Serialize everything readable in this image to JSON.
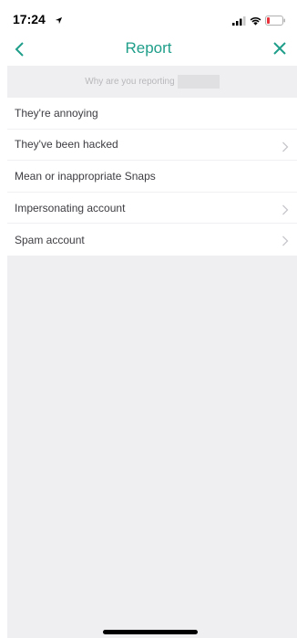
{
  "status_bar": {
    "time": "17:24",
    "icons": [
      "location-arrow-icon",
      "signal-icon",
      "wifi-icon",
      "battery-low-icon"
    ]
  },
  "nav": {
    "title": "Report",
    "back_icon": "chevron-left-icon",
    "close_icon": "close-icon",
    "accent_color": "#1f9e8a"
  },
  "prompt": {
    "text": "Why are you reporting"
  },
  "options": [
    {
      "label": "They're annoying",
      "has_chevron": false
    },
    {
      "label": "They've been hacked",
      "has_chevron": true
    },
    {
      "label": "Mean or inappropriate Snaps",
      "has_chevron": false
    },
    {
      "label": "Impersonating account",
      "has_chevron": true
    },
    {
      "label": "Spam account",
      "has_chevron": true
    }
  ]
}
